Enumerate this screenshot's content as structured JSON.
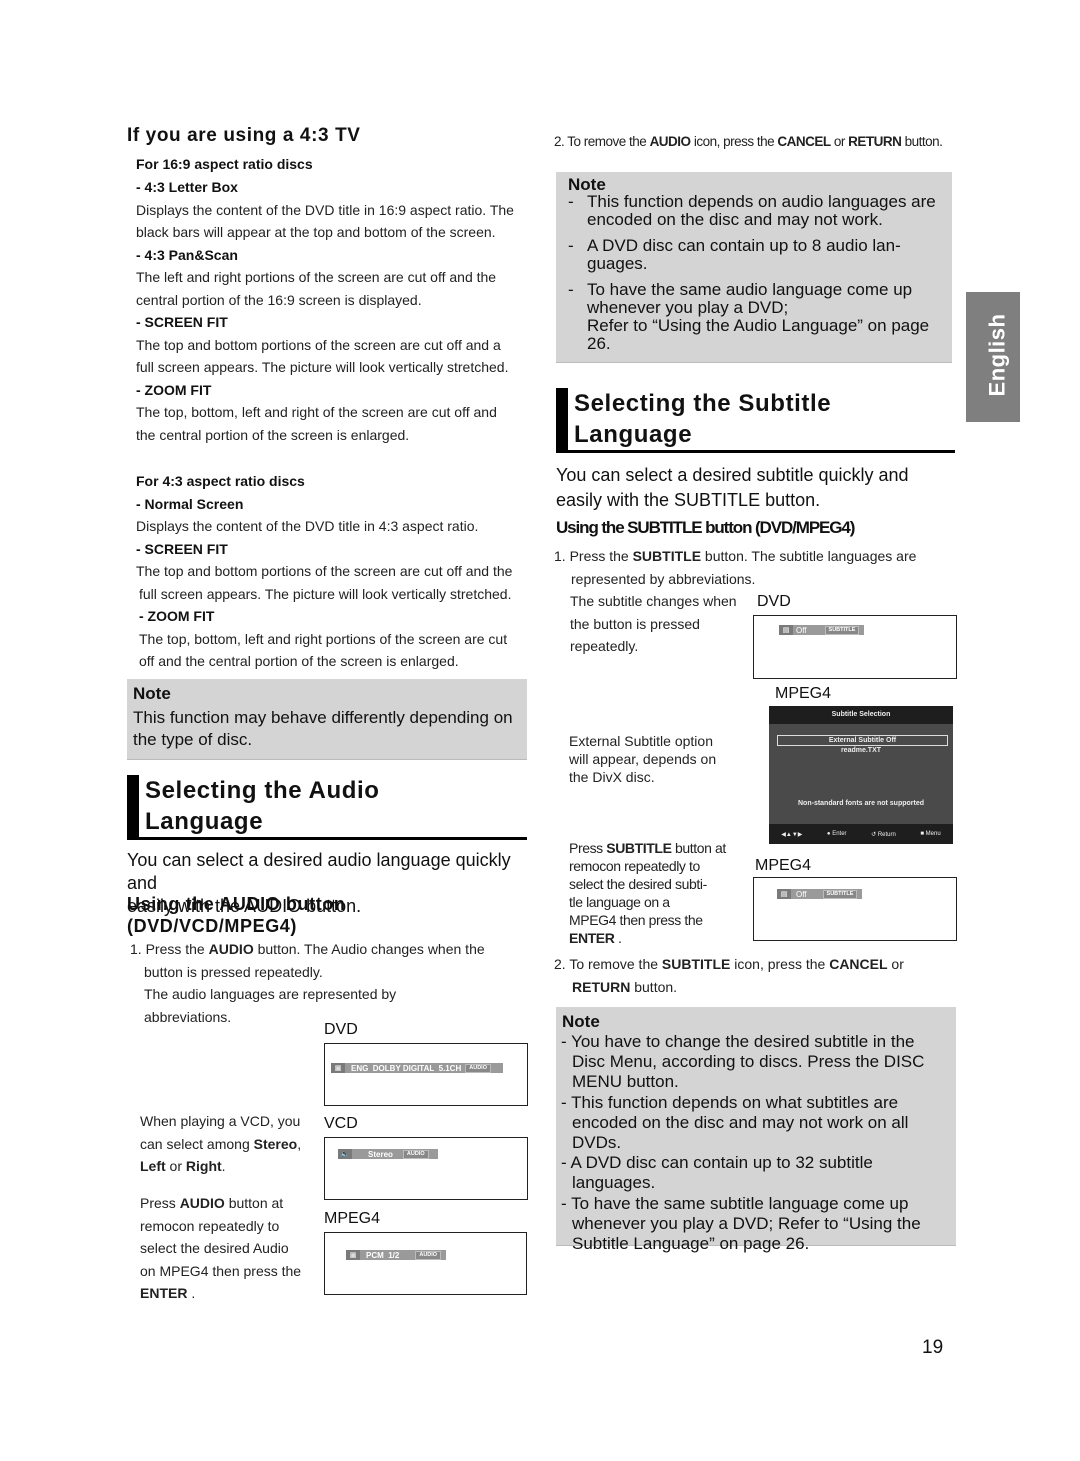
{
  "left": {
    "tv43_heading": "If you are using a 4:3 TV",
    "group169": {
      "title": "For 16:9 aspect ratio discs",
      "items": [
        {
          "name": "- 4:3 Letter Box",
          "desc1": "Displays the content of the DVD title in 16:9 aspect ratio. The",
          "desc2": "black bars will appear at the top and bottom of the screen."
        },
        {
          "name": "- 4:3 Pan&Scan",
          "desc1": "The left and right portions of the screen are cut off and the",
          "desc2": "central portion of the 16:9 screen is displayed."
        },
        {
          "name": "- SCREEN FIT",
          "desc1": "The top and bottom portions of the screen are cut off and a",
          "desc2": "full screen appears. The picture will look vertically stretched."
        },
        {
          "name": "- ZOOM FIT",
          "desc1": "The top, bottom, left and right of the screen are cut off and",
          "desc2": "the central portion of the screen is enlarged."
        }
      ]
    },
    "group43": {
      "title": "For 4:3 aspect ratio discs",
      "items": [
        {
          "name": "- Normal Screen",
          "desc1": "Displays the content of the DVD title in 4:3 aspect ratio.",
          "desc2": ""
        },
        {
          "name": "- SCREEN FIT",
          "desc1": "The top and bottom portions of the screen are cut off and the",
          "desc2": "full screen appears. The picture will look vertically stretched."
        },
        {
          "name": "- ZOOM FIT",
          "desc1": "The top, bottom, left and right portions of the screen are cut",
          "desc2": "off and the central portion of the screen is enlarged."
        }
      ]
    },
    "note": {
      "title": "Note",
      "line1": "This function may behave differently depending on",
      "line2": "the type of disc."
    },
    "audio_section": {
      "title_line1": "Selecting the Audio",
      "title_line2": "Language",
      "lead1": "You can select a desired audio language quickly and",
      "lead2": "easily with the AUDIO button.",
      "subheading1": "Using the AUDIO button",
      "subheading2": "(DVD/VCD/MPEG4)",
      "step1_prefix": "1. Press the ",
      "step1_bold": "AUDIO",
      "step1_rest": " button. The Audio changes when the",
      "step1_line2": "button is pressed repeatedly.",
      "step1_line3": "The audio languages are represented by",
      "step1_line4": "abbreviations.",
      "vcd_text": {
        "l1": "When playing a VCD, you",
        "l2a": "can select among ",
        "l2b": "Stereo",
        "l2c": ",",
        "l3a": "Left",
        "l3b": " or ",
        "l3c": "Right",
        "l3d": "."
      },
      "mpeg4_text": {
        "l1a": "Press ",
        "l1b": "AUDIO",
        "l1c": " button at",
        "l2": "remocon repeatedly to",
        "l3": "select the desired Audio",
        "l4": "on MPEG4 then press the",
        "l5a": "ENTER",
        "l5b": " ."
      },
      "osd": [
        {
          "label": "DVD",
          "icon": "disc-audio-icon",
          "value": "ENG  DOLBY DIGITAL  5.1CH",
          "tag": "AUDIO"
        },
        {
          "label": "VCD",
          "icon": "speaker-icon",
          "value": "Stereo",
          "tag": "AUDIO"
        },
        {
          "label": "MPEG4",
          "icon": "disc-audio-icon",
          "value": "PCM  1/2",
          "tag": "AUDIO"
        }
      ]
    }
  },
  "right": {
    "step2_prefix": "2. To remove the ",
    "step2_b1": "AUDIO",
    "step2_mid": " icon, press the ",
    "step2_b2": "CANCEL",
    "step2_or": " or ",
    "step2_b3": "RETURN",
    "step2_end": " button.",
    "audio_note": {
      "title": "Note",
      "items": [
        {
          "l1": "This function depends on audio languages are",
          "l2": "encoded on the disc and may not work.",
          "l3": ""
        },
        {
          "l1": "A DVD disc can contain up to 8 audio lan-",
          "l2": "guages.",
          "l3": ""
        },
        {
          "l1": "To have the same audio language come up",
          "l2": "whenever you play a DVD;",
          "l3": "Refer to “Using the Audio Language” on page",
          "l4": "26."
        }
      ]
    },
    "subtitle_section": {
      "title_line1": "Selecting the Subtitle",
      "title_line2": "Language",
      "lead1": "You can select a desired subtitle quickly and",
      "lead2": "easily with the SUBTITLE button.",
      "subheading": "Using the SUBTITLE button (DVD/MPEG4)",
      "step1_prefix": "1. Press the ",
      "step1_bold": "SUBTITLE",
      "step1_rest": " button. The subtitle languages are",
      "step1_line2": "represented by abbreviations.",
      "changes": {
        "l1": "The subtitle changes when",
        "l2": "the button is pressed",
        "l3": "repeatedly."
      },
      "external": {
        "l1": "External Subtitle option",
        "l2": "will appear, depends on",
        "l3": "the DivX disc."
      },
      "press": {
        "l1a": "Press ",
        "l1b": "SUBTITLE",
        "l1c": " button at",
        "l2": "remocon repeatedly to",
        "l3": "select the desired subti-",
        "l4": "tle language on a",
        "l5": "MPEG4 then press the",
        "l6a": "ENTER",
        "l6b": " ."
      },
      "step2_prefix": "2. To remove the ",
      "step2_b1": "SUBTITLE",
      "step2_mid": " icon, press the ",
      "step2_b2": "CANCEL",
      "step2_or": " or",
      "step2_b3": "RETURN",
      "step2_end": " button.",
      "osd_dvd": {
        "label": "DVD",
        "icon": "subtitle-icon",
        "value": "Off",
        "tag": "SUBTITLE"
      },
      "osd_mpeg4_menu": {
        "label": "MPEG4",
        "header": "Subtitle Selection",
        "option_selected": "External Subtitle Off",
        "option_file": "readme.TXT",
        "warning": "Non-standard fonts are not supported",
        "footer": [
          {
            "icon": "arrow-keys-icon",
            "label": ""
          },
          {
            "icon": "enter-icon",
            "label": "Enter"
          },
          {
            "icon": "return-icon",
            "label": "Return"
          },
          {
            "icon": "menu-icon",
            "label": "Menu"
          }
        ]
      },
      "osd_mpeg4": {
        "label": "MPEG4",
        "icon": "subtitle-icon",
        "value": "Off",
        "tag": "SUBTITLE"
      },
      "note": {
        "title": "Note",
        "items": [
          {
            "l1": "- You have to change the desired subtitle in the",
            "l2": "Disc Menu, according to discs. Press the DISC",
            "l3": "MENU button."
          },
          {
            "l1": "- This function depends on what subtitles are",
            "l2": "encoded on the disc and may not work on all DVDs.",
            "l3": ""
          },
          {
            "l1": "- A  DVD disc can contain up to 32 subtitle",
            "l2": "languages.",
            "l3": ""
          },
          {
            "l1": "- To have the same subtitle language come up",
            "l2": "whenever you play a DVD; Refer to “Using the",
            "l3": "Subtitle Language” on page 26."
          }
        ]
      }
    }
  },
  "side_tab": "English",
  "page_number": "19"
}
